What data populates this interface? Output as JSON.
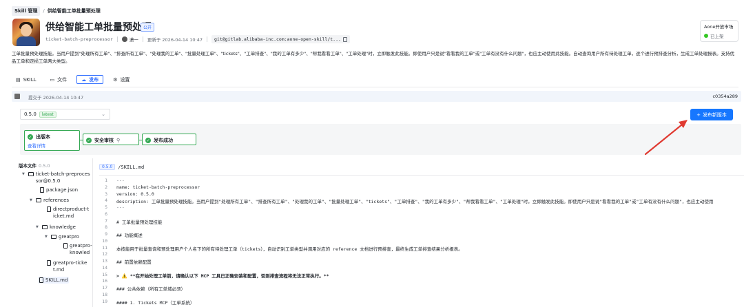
{
  "breadcrumb": {
    "root": "Skill 管理",
    "sep": "/",
    "current": "供给智能工单批量预处理"
  },
  "header": {
    "title": "供给智能工单批量预处理",
    "visibility": "公开",
    "slug": "ticket-batch-preprocessor",
    "author": "潇一",
    "updated": "更新于 2026-04-14 10:47",
    "git": "git@gitlab.alibaba-inc.com:aone-open-skill/t..."
  },
  "market": {
    "title": "Aone开放市场",
    "status": "已上架"
  },
  "description": "工单批量预处理技能。当用户提到\"处理所有工单\"、\"排查所有工单\"、\"处理我的工单\"、\"批量处理工单\"、\"tickets\"、\"工单排查\"、\"我的工单有多少\"、\"帮我看看工单\"、\"工单处理\"时，立即触发此技能。即使用户只是说\"看看我的工单\"或\"工单有没有什么问题\"，也应主动使用此技能。自动查询用户所有待处理工单，逐个进行预排查分析，生成工单处理报表。支持优品工单和定损工单两大类型。",
  "tabs": [
    {
      "label": "SKILL",
      "icon": "document-icon"
    },
    {
      "label": "文件",
      "icon": "folder-icon"
    },
    {
      "label": "发布",
      "icon": "upload-icon"
    },
    {
      "label": "设置",
      "icon": "gear-icon"
    }
  ],
  "commit": {
    "text": "提交于 2026-04-14 10:47",
    "hash": "c0354a289"
  },
  "version": {
    "value": "0.5.0",
    "tag": "latest"
  },
  "publish_button": "发布新版本",
  "steps": [
    {
      "label": "出版本",
      "link": "查看详情"
    },
    {
      "label": "安全审核"
    },
    {
      "label": "发布成功"
    }
  ],
  "tree": {
    "title": "版本文件",
    "version": "0.5.0",
    "items": [
      {
        "label": "ticket-batch-preprocessor@0.5.0",
        "type": "folder",
        "twisty": "▼"
      },
      {
        "label": "package.json",
        "type": "file"
      },
      {
        "label": "references",
        "type": "folder",
        "twisty": "▼"
      },
      {
        "label": "directproduct-ticket.md",
        "type": "file"
      },
      {
        "label": "knowledge",
        "type": "folder",
        "twisty": "▼"
      },
      {
        "label": "greatpro",
        "type": "folder",
        "twisty": "▼"
      },
      {
        "label": "greatpro-knowledge.md",
        "type": "file"
      },
      {
        "label": "greatpro-ticket.md",
        "type": "file"
      },
      {
        "label": "SKILL.md",
        "type": "file"
      }
    ]
  },
  "file": {
    "version": "0.5.0",
    "path": "/SKILL.md"
  },
  "code_lines": [
    {
      "n": "1",
      "t": "---"
    },
    {
      "n": "2",
      "t": "name: ticket-batch-preprocessor"
    },
    {
      "n": "3",
      "t": "version: 0.5.0"
    },
    {
      "n": "4",
      "t": "description: 工单批量预处理技能。当用户提到\"处理所有工单\"、\"排查所有工单\"、\"处理我的工单\"、\"批量处理工单\"、\"tickets\"、\"工单排查\"、\"我的工单有多少\"、\"帮我看看工单\"、\"工单处理\"时，立即触发此技能。即使用户只是说\"看看我的工单\"或\"工单有没有什么问题\"，也应主动使用"
    },
    {
      "n": "5",
      "t": "---"
    },
    {
      "n": "6",
      "t": ""
    },
    {
      "n": "7",
      "t": "# 工单批量预处理技能"
    },
    {
      "n": "8",
      "t": ""
    },
    {
      "n": "9",
      "t": "## 功能概述"
    },
    {
      "n": "10",
      "t": ""
    },
    {
      "n": "11",
      "t": "本技能用于批量查询和预处理用户个人名下的所有待处理工单（tickets），自动识别工单类型并调用对应的 reference 文档进行预排查，最终生成工单排查结果分析报表。"
    },
    {
      "n": "12",
      "t": ""
    },
    {
      "n": "13",
      "t": "## 前置依赖配置"
    },
    {
      "n": "14",
      "t": ""
    },
    {
      "n": "15",
      "t": "> ⚠️ **在开始处理工单前，请确认以下 MCP 工具已正确安装和配置，否则排查流程将无法正常执行。**"
    },
    {
      "n": "16",
      "t": ""
    },
    {
      "n": "17",
      "t": "### 公共依赖（所有工单域必须）"
    },
    {
      "n": "18",
      "t": ""
    },
    {
      "n": "19",
      "t": "#### 1. Tickets MCP（工单系统）"
    }
  ]
}
